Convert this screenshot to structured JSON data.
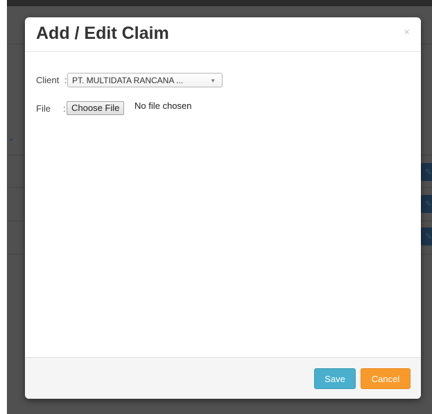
{
  "modal": {
    "title": "Add / Edit Claim",
    "close_glyph": "×"
  },
  "form": {
    "client_label": "Client",
    "client_colon": ":",
    "client_value": "PT. MULTIDATA RANCANA ...",
    "file_label": "File",
    "file_colon": ":",
    "choose_file_label": "Choose File",
    "file_status": "No file chosen"
  },
  "footer": {
    "save_label": "Save",
    "cancel_label": "Cancel"
  },
  "icons": {
    "select_arrow": "▼",
    "sort_arrow": "▲",
    "edit": "pencil-icon"
  },
  "colors": {
    "save": "#49afcd",
    "cancel": "#f89a2b",
    "backdrop": "#505050"
  }
}
